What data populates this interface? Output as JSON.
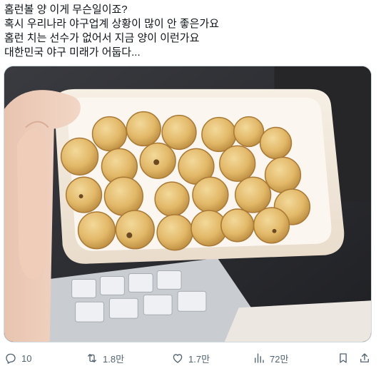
{
  "tweet": {
    "lines": [
      "홈런볼 양 이게 무슨일이죠?",
      "혹시 우리나라 야구업계 상황이 많이 안 좋은가요",
      "홈런 치는 선수가 없어서 지금 양이 이런가요",
      "대한민국 야구 미래가 어둡다..."
    ]
  },
  "actions": {
    "reply_count": "10",
    "retweet_count": "1.8만",
    "like_count": "1.7만",
    "views_count": "72만"
  },
  "colors": {
    "text": "#0f1419",
    "muted": "#536471",
    "border": "#cfd9de"
  },
  "icons": [
    "reply-icon",
    "retweet-icon",
    "like-icon",
    "views-icon",
    "bookmark-icon",
    "share-icon"
  ]
}
